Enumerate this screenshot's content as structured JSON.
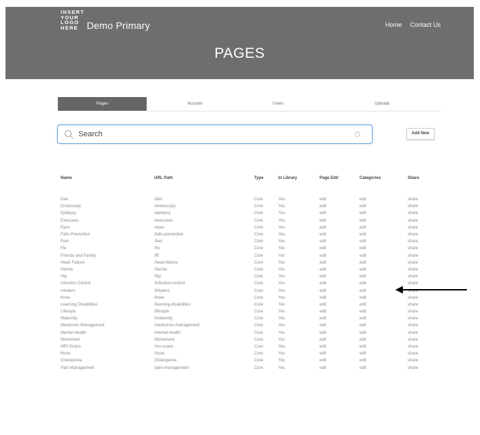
{
  "header": {
    "logo_lines": [
      "INSERT",
      "YOUR",
      "LOGO",
      "HERE"
    ],
    "brand": "Demo Primary",
    "nav": [
      "Home",
      "Contact Us"
    ],
    "page_title": "PAGES"
  },
  "tabs": [
    "Pages",
    "Account",
    "Users",
    "Uploads"
  ],
  "search": {
    "placeholder": "Search"
  },
  "add_new_label": "Add New",
  "table": {
    "columns": [
      "Name",
      "URL Path",
      "Type",
      "In Library",
      "Page Edit",
      "Categories",
      "Share"
    ],
    "rows": [
      {
        "name": "Diet",
        "url": "/diet",
        "type": "Core",
        "library": "Yes",
        "edit": "edit",
        "categories": "edit",
        "share": "share"
      },
      {
        "name": "Endoscopy",
        "url": "/endoscopy",
        "type": "Core",
        "library": "Yes",
        "edit": "edit",
        "categories": "edit",
        "share": "share"
      },
      {
        "name": "Epilepsy",
        "url": "/epilepsy",
        "type": "Core",
        "library": "Yes",
        "edit": "edit",
        "categories": "edit",
        "share": "share"
      },
      {
        "name": "Exercises",
        "url": "/exercises",
        "type": "Core",
        "library": "Yes",
        "edit": "edit",
        "categories": "edit",
        "share": "share"
      },
      {
        "name": "Eyes",
        "url": "/eyes",
        "type": "Core",
        "library": "Yes",
        "edit": "edit",
        "categories": "edit",
        "share": "share"
      },
      {
        "name": "Falls Prevention",
        "url": "/falls-prevention",
        "type": "Core",
        "library": "Yes",
        "edit": "edit",
        "categories": "edit",
        "share": "share"
      },
      {
        "name": "Feet",
        "url": "/feet",
        "type": "Core",
        "library": "Yes",
        "edit": "edit",
        "categories": "edit",
        "share": "share"
      },
      {
        "name": "Flu",
        "url": "/flu",
        "type": "Core",
        "library": "Yes",
        "edit": "edit",
        "categories": "edit",
        "share": "share"
      },
      {
        "name": "Friends and Family",
        "url": "/fff",
        "type": "Core",
        "library": "Yes",
        "edit": "edit",
        "categories": "edit",
        "share": "share"
      },
      {
        "name": "Heart Failure",
        "url": "/heart-failure",
        "type": "Core",
        "library": "Yes",
        "edit": "edit",
        "categories": "edit",
        "share": "share"
      },
      {
        "name": "Hernia",
        "url": "/hernia",
        "type": "Core",
        "library": "Yes",
        "edit": "edit",
        "categories": "edit",
        "share": "share"
      },
      {
        "name": "Hip",
        "url": "/hip",
        "type": "Core",
        "library": "Yes",
        "edit": "edit",
        "categories": "edit",
        "share": "share"
      },
      {
        "name": "Infection Control",
        "url": "/infection-control",
        "type": "Core",
        "library": "Yes",
        "edit": "edit",
        "categories": "edit",
        "share": "share"
      },
      {
        "name": "Inhalers",
        "url": "/inhalers",
        "type": "Core",
        "library": "Yes",
        "edit": "edit",
        "categories": "edit",
        "share": "share"
      },
      {
        "name": "Knee",
        "url": "/knee",
        "type": "Core",
        "library": "Yes",
        "edit": "edit",
        "categories": "edit",
        "share": "share"
      },
      {
        "name": "Learning Disabilities",
        "url": "/learning-disabilities",
        "type": "Core",
        "library": "Yes",
        "edit": "edit",
        "categories": "edit",
        "share": "share"
      },
      {
        "name": "Lifestyle",
        "url": "/lifestyle",
        "type": "Core",
        "library": "Yes",
        "edit": "edit",
        "categories": "edit",
        "share": "share"
      },
      {
        "name": "Maternity",
        "url": "/maternity",
        "type": "Core",
        "library": "Yes",
        "edit": "edit",
        "categories": "edit",
        "share": "share"
      },
      {
        "name": "Medicines Management",
        "url": "/medicines-management",
        "type": "Core",
        "library": "Yes",
        "edit": "edit",
        "categories": "edit",
        "share": "share"
      },
      {
        "name": "Mental Health",
        "url": "/mental-health",
        "type": "Core",
        "library": "Yes",
        "edit": "edit",
        "categories": "edit",
        "share": "share"
      },
      {
        "name": "Movement",
        "url": "/Movement",
        "type": "Core",
        "library": "Yes",
        "edit": "edit",
        "categories": "edit",
        "share": "share"
      },
      {
        "name": "MRI Scans",
        "url": "/mri-scans",
        "type": "Core",
        "library": "Yes",
        "edit": "edit",
        "categories": "edit",
        "share": "share"
      },
      {
        "name": "Nose",
        "url": "/nose",
        "type": "Core",
        "library": "Yes",
        "edit": "edit",
        "categories": "edit",
        "share": "share"
      },
      {
        "name": "Osteopenia",
        "url": "/Osteopenia",
        "type": "Core",
        "library": "Yes",
        "edit": "edit",
        "categories": "edit",
        "share": "share"
      },
      {
        "name": "Pain Management",
        "url": "/pain-management",
        "type": "Core",
        "library": "Yes",
        "edit": "edit",
        "categories": "edit",
        "share": "share"
      }
    ]
  },
  "icons": {
    "search": "search-icon",
    "clear": "clear-icon",
    "arrow": "arrow-icon"
  },
  "colors": {
    "header_bg": "#6e6e6e",
    "active_tab": "#666666",
    "search_border": "#6aa3dd"
  }
}
